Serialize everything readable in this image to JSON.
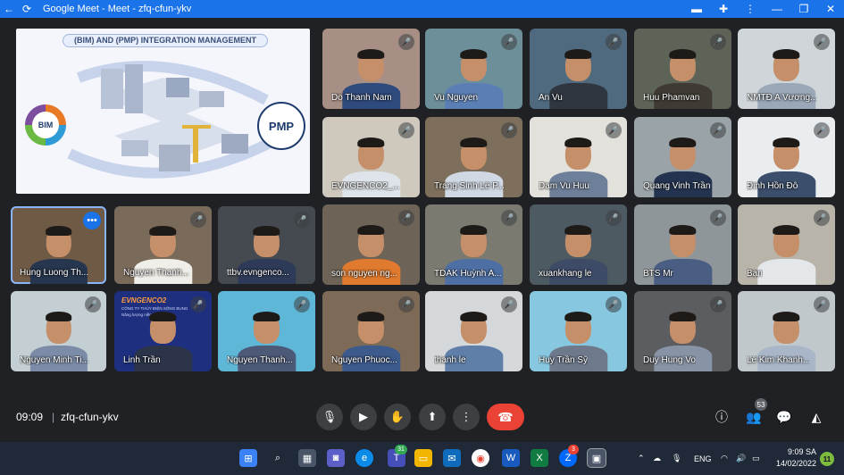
{
  "window": {
    "title": "Google Meet - Meet - zfq-cfun-ykv"
  },
  "slide": {
    "title": "(BIM) AND (PMP) INTEGRATION MANAGEMENT",
    "left_logo": "BIM",
    "right_logo": "PMP"
  },
  "participants": [
    {
      "name": "Do Thanh Nam"
    },
    {
      "name": "Vu Nguyen"
    },
    {
      "name": "An Vu"
    },
    {
      "name": "Huu Phamvan"
    },
    {
      "name": "NMTĐ A Vương..."
    },
    {
      "name": "EVNGENCO2_..."
    },
    {
      "name": "Trang Sinh Lê P..."
    },
    {
      "name": "Dam Vu Huu"
    },
    {
      "name": "Quang Vinh Trần"
    },
    {
      "name": "Đinh Hồn Đỗ"
    },
    {
      "name": "Hung Luong Th..."
    },
    {
      "name": "Nguyen Thanh..."
    },
    {
      "name": "ttbv.evngenco..."
    },
    {
      "name": "son nguyen ng..."
    },
    {
      "name": "TDAK Huỳnh A..."
    },
    {
      "name": "xuankhang le"
    },
    {
      "name": "BTS Mr"
    },
    {
      "name": "Bạn"
    },
    {
      "name": "Nguyen Minh Ti..."
    },
    {
      "name": "Linh Trần"
    },
    {
      "name": "Nguyen Thanh..."
    },
    {
      "name": "Nguyen Phuoc..."
    },
    {
      "name": "thanh le"
    },
    {
      "name": "Huy Trần Sỹ"
    },
    {
      "name": "Duy Hung Vo"
    },
    {
      "name": "Lê Kim Khanh..."
    }
  ],
  "linh_tile": {
    "brand": "EVNGENCO2",
    "subtitle": "CÔNG TY THỦY ĐIỆN SÔNG BUNG",
    "line": "Năng lượng niềm tin"
  },
  "meeting": {
    "time": "09:09",
    "separator": "|",
    "code": "zfq-cfun-ykv",
    "participant_count": "53"
  },
  "taskbar": {
    "teams_badge": "31",
    "zalo_badge": "3",
    "lang": "ENG",
    "time": "9:09 SA",
    "date": "14/02/2022",
    "notifications": "11"
  }
}
